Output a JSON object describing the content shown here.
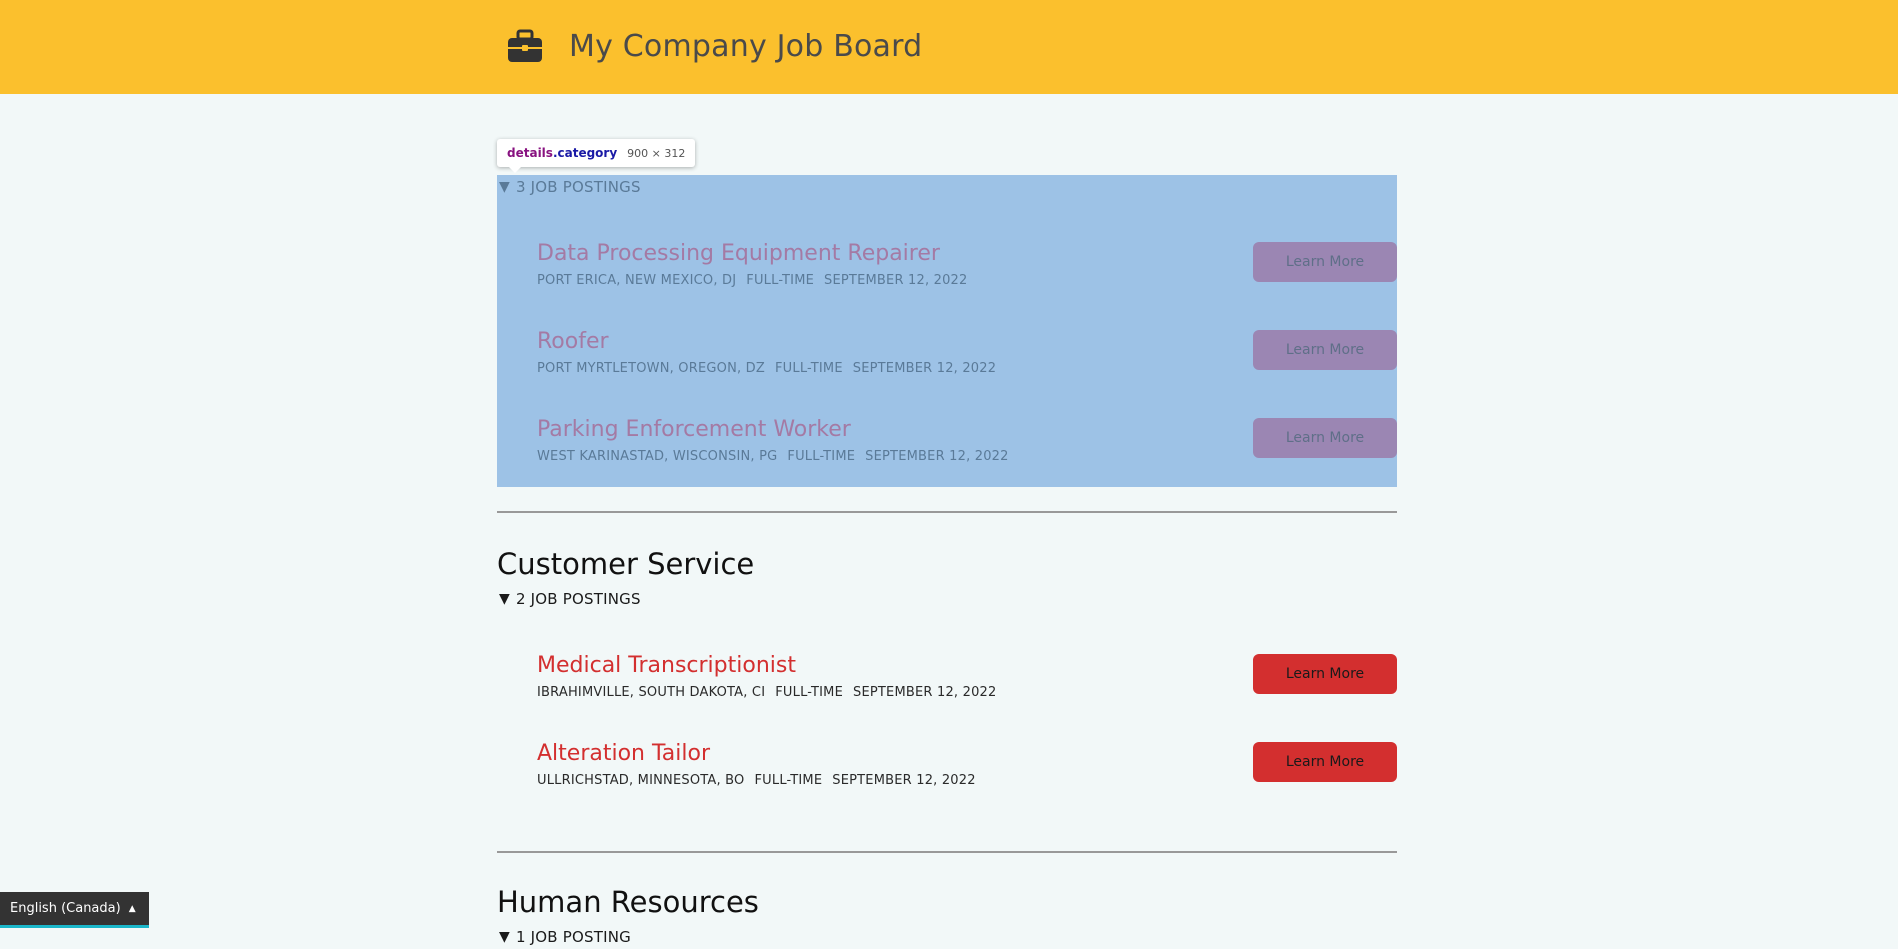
{
  "header": {
    "title": "My Company Job Board",
    "background": "#fbc02d",
    "icon": "briefcase-icon"
  },
  "tooltip": {
    "tag": "details",
    "class": ".category",
    "size": "900 × 312"
  },
  "categories": [
    {
      "heading": "",
      "summary": "3 JOB POSTINGS",
      "jobs": [
        {
          "title": "Data Processing Equipment Repairer",
          "location": "PORT ERICA, NEW MEXICO, DJ",
          "type": "FULL-TIME",
          "date": "SEPTEMBER 12, 2022",
          "button": "Learn More"
        },
        {
          "title": "Roofer",
          "location": "PORT MYRTLETOWN, OREGON, DZ",
          "type": "FULL-TIME",
          "date": "SEPTEMBER 12, 2022",
          "button": "Learn More"
        },
        {
          "title": "Parking Enforcement Worker",
          "location": "WEST KARINASTAD, WISCONSIN, PG",
          "type": "FULL-TIME",
          "date": "SEPTEMBER 12, 2022",
          "button": "Learn More"
        }
      ]
    },
    {
      "heading": "Customer Service",
      "summary": "2 JOB POSTINGS",
      "jobs": [
        {
          "title": "Medical Transcriptionist",
          "location": "IBRAHIMVILLE, SOUTH DAKOTA, CI",
          "type": "FULL-TIME",
          "date": "SEPTEMBER 12, 2022",
          "button": "Learn More"
        },
        {
          "title": "Alteration Tailor",
          "location": "ULLRICHSTAD, MINNESOTA, BO",
          "type": "FULL-TIME",
          "date": "SEPTEMBER 12, 2022",
          "button": "Learn More"
        }
      ]
    },
    {
      "heading": "Human Resources",
      "summary": "1 JOB POSTING",
      "jobs": []
    }
  ],
  "language": {
    "label": "English (Canada)"
  },
  "colors": {
    "accent": "#d32f2f",
    "highlight": "#9dc2e6"
  }
}
